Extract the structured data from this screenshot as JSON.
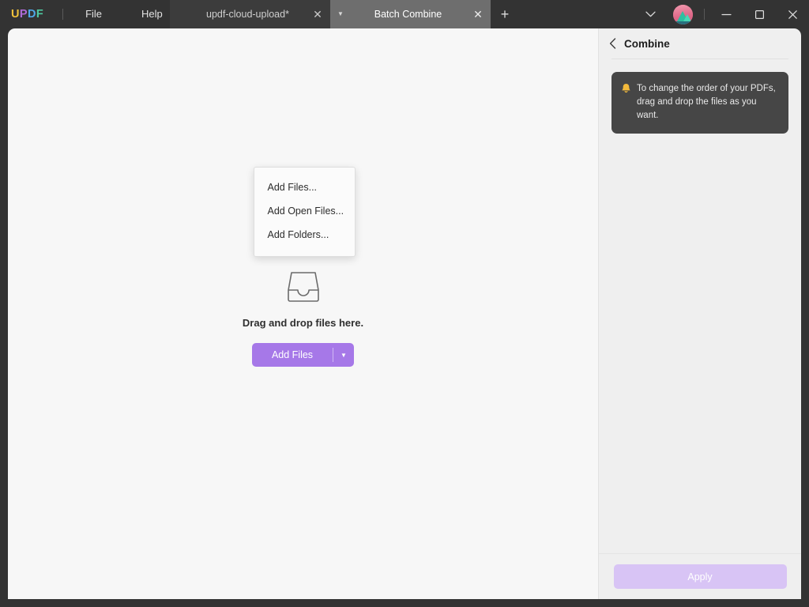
{
  "window": {
    "logo_letters": [
      "U",
      "P",
      "D",
      "F"
    ],
    "menus": [
      {
        "label": "File",
        "name": "menu-file"
      },
      {
        "label": "Help",
        "name": "menu-help"
      }
    ],
    "tabs": [
      {
        "label": "updf-cloud-upload*",
        "active": false
      },
      {
        "label": "Batch Combine",
        "active": true
      }
    ],
    "new_tab_label": "+",
    "controls": {
      "chevron": "chevron-down",
      "minimize": "minimize",
      "maximize": "maximize",
      "close": "close"
    }
  },
  "main": {
    "drop_text": "Drag and drop files here.",
    "add_files_label": "Add Files",
    "menu_items": [
      {
        "label": "Add Files..."
      },
      {
        "label": "Add Open Files..."
      },
      {
        "label": "Add Folders..."
      }
    ]
  },
  "panel": {
    "title": "Combine",
    "tip": "To change the order of your PDFs, drag and drop the files as you want.",
    "apply_label": "Apply"
  },
  "colors": {
    "accent_purple": "#a678e8",
    "apply_disabled": "#d8c4f5",
    "titlebar": "#333333",
    "tab_active": "#6e6e6e",
    "tab_inactive": "#3c3c3c",
    "panel_bg": "#efefef",
    "tip_bg": "#464646",
    "bell_yellow": "#f2b93b"
  }
}
